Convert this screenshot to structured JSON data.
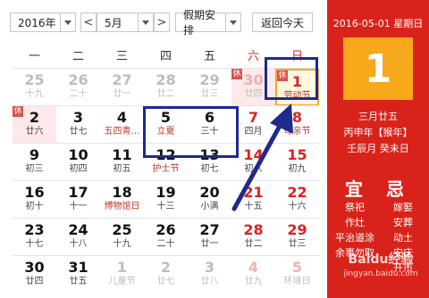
{
  "toolbar": {
    "year": "2016年",
    "prev": "<",
    "month": "5月",
    "next": ">",
    "holiday_select": "假期安排",
    "today_button": "返回今天"
  },
  "weekdays": [
    "一",
    "二",
    "三",
    "四",
    "五",
    "六",
    "日"
  ],
  "rows": [
    [
      {
        "day": "25",
        "lunar": "十九",
        "other": true
      },
      {
        "day": "26",
        "lunar": "二十",
        "other": true
      },
      {
        "day": "27",
        "lunar": "廿一",
        "other": true
      },
      {
        "day": "28",
        "lunar": "廿二",
        "other": true
      },
      {
        "day": "29",
        "lunar": "廿三",
        "other": true
      },
      {
        "day": "30",
        "lunar": "廿四",
        "other": true,
        "badge": "休"
      },
      {
        "day": "1",
        "lunar": "劳动节",
        "badge": "休",
        "festival": true
      }
    ],
    [
      {
        "day": "2",
        "lunar": "廿六",
        "badge": "休"
      },
      {
        "day": "3",
        "lunar": "廿七"
      },
      {
        "day": "4",
        "lunar": "五四青…",
        "festival": true
      },
      {
        "day": "5",
        "lunar": "立夏",
        "festival": true
      },
      {
        "day": "6",
        "lunar": "三十"
      },
      {
        "day": "7",
        "lunar": "四月"
      },
      {
        "day": "8",
        "lunar": "母亲节",
        "festival": true
      }
    ],
    [
      {
        "day": "9",
        "lunar": "初三"
      },
      {
        "day": "10",
        "lunar": "初四"
      },
      {
        "day": "11",
        "lunar": "初五"
      },
      {
        "day": "12",
        "lunar": "护士节",
        "festival": true
      },
      {
        "day": "13",
        "lunar": "初七"
      },
      {
        "day": "14",
        "lunar": "初八"
      },
      {
        "day": "15",
        "lunar": "初九"
      }
    ],
    [
      {
        "day": "16",
        "lunar": "初十"
      },
      {
        "day": "17",
        "lunar": "十一"
      },
      {
        "day": "18",
        "lunar": "博物馆日",
        "festival": true
      },
      {
        "day": "19",
        "lunar": "十三"
      },
      {
        "day": "20",
        "lunar": "小满"
      },
      {
        "day": "21",
        "lunar": "十五"
      },
      {
        "day": "22",
        "lunar": "十六"
      }
    ],
    [
      {
        "day": "23",
        "lunar": "十七"
      },
      {
        "day": "24",
        "lunar": "十八"
      },
      {
        "day": "25",
        "lunar": "十九"
      },
      {
        "day": "26",
        "lunar": "二十"
      },
      {
        "day": "27",
        "lunar": "廿一"
      },
      {
        "day": "28",
        "lunar": "廿二"
      },
      {
        "day": "29",
        "lunar": "廿三"
      }
    ],
    [
      {
        "day": "30",
        "lunar": "廿四"
      },
      {
        "day": "31",
        "lunar": "廿五"
      },
      {
        "day": "1",
        "lunar": "儿童节",
        "other": true
      },
      {
        "day": "2",
        "lunar": "廿七",
        "other": true
      },
      {
        "day": "3",
        "lunar": "廿八",
        "other": true
      },
      {
        "day": "4",
        "lunar": "廿九",
        "other": true
      },
      {
        "day": "5",
        "lunar": "环境日",
        "other": true
      }
    ]
  ],
  "panel": {
    "date_line": "2016-05-01 星期日",
    "big_day": "1",
    "lunar_date": "三月廿五",
    "ganzhi_year": "丙申年【猴年】",
    "ganzhi_month_day": "壬辰月 癸未日",
    "yi_title": "宜",
    "ji_title": "忌",
    "yi_items": [
      "祭祀",
      "作灶",
      "平治道涂",
      "余事勿取"
    ],
    "ji_items": [
      "嫁娶",
      "安葬",
      "动土",
      "安床",
      "开市"
    ]
  },
  "watermark": "Baidu经验",
  "watermark_url": "jingyan.baidu.com",
  "colors": {
    "panel_red": "#d9231a",
    "today_orange": "#f7a81b",
    "weekend_red": "#e02020",
    "annotation_blue": "#1f2a8c"
  }
}
